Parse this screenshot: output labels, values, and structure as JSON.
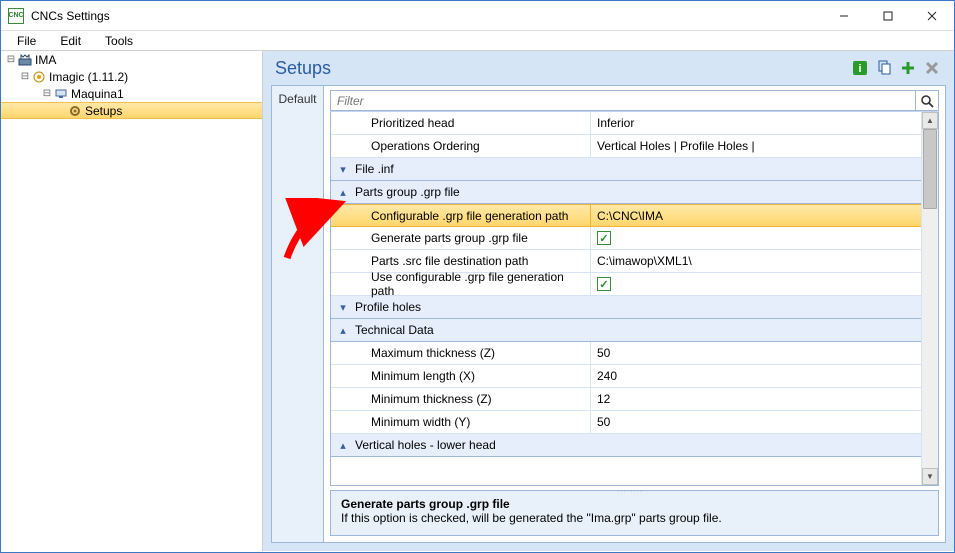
{
  "window": {
    "title": "CNCs Settings"
  },
  "menubar": {
    "items": [
      "File",
      "Edit",
      "Tools"
    ]
  },
  "tree": {
    "root": {
      "label": "IMA"
    },
    "node1": {
      "label": "Imagic (1.11.2)"
    },
    "node2": {
      "label": "Maquina1"
    },
    "node3": {
      "label": "Setups"
    }
  },
  "main": {
    "title": "Setups",
    "tab": "Default",
    "filter_placeholder": "Filter"
  },
  "rows": {
    "prioritized_head": {
      "label": "Prioritized head",
      "value": "Inferior"
    },
    "operations_ordering": {
      "label": "Operations Ordering",
      "value": "Vertical Holes | Profile Holes |"
    },
    "grp_file_inf": "File .inf",
    "grp_parts_group": "Parts group .grp file",
    "cfg_grp_path": {
      "label": "Configurable .grp file generation path",
      "value": "C:\\CNC\\IMA"
    },
    "gen_grp": {
      "label": "Generate parts group .grp file",
      "value": true
    },
    "src_dest": {
      "label": "Parts .src file destination path",
      "value": "C:\\imawop\\XML1\\"
    },
    "use_cfg": {
      "label": "Use configurable .grp file generation path",
      "value": true
    },
    "grp_profile": "Profile holes",
    "grp_technical": "Technical Data",
    "max_thick": {
      "label": "Maximum thickness (Z)",
      "value": "50"
    },
    "min_len": {
      "label": "Minimum length (X)",
      "value": "240"
    },
    "min_thick": {
      "label": "Minimum thickness (Z)",
      "value": "12"
    },
    "min_width": {
      "label": "Minimum width (Y)",
      "value": "50"
    },
    "grp_vertical": "Vertical holes - lower head"
  },
  "help": {
    "title": "Generate parts group .grp file",
    "body": "If this option is checked, will be generated the \"Ima.grp\" parts group file."
  }
}
